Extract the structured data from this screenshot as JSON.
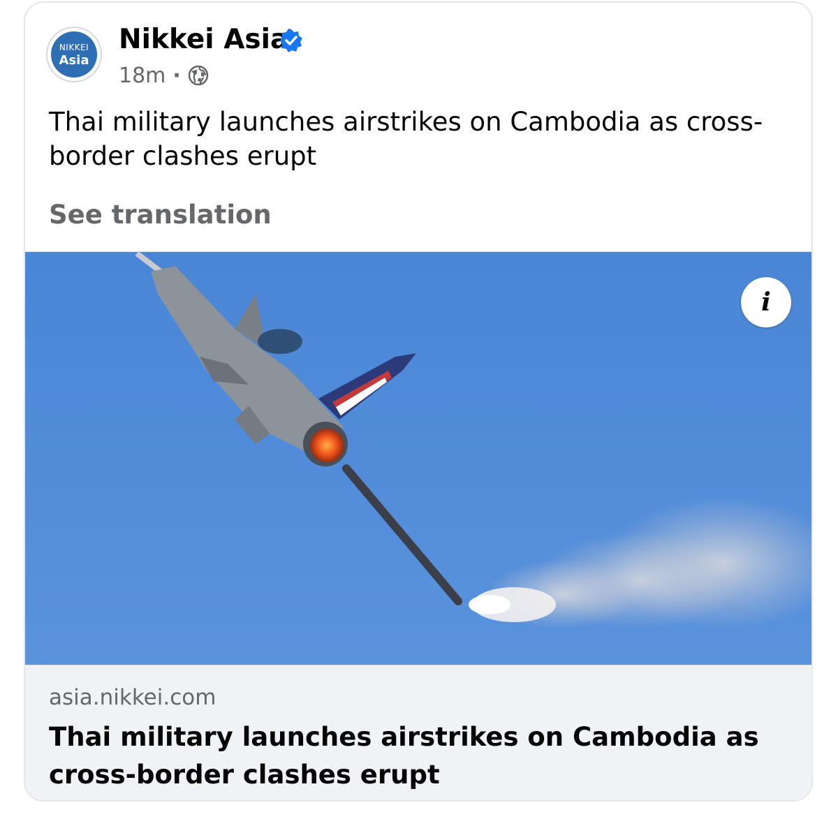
{
  "post": {
    "page_name": "Nikkei Asia",
    "avatar_line1": "NIKKEI",
    "avatar_line2": "Asia",
    "timestamp": "18m",
    "separator": "·",
    "audience_icon": "globe-icon",
    "verified_icon": "verified-badge-icon",
    "text": "Thai military launches airstrikes on Cambodia as cross-border clashes erupt",
    "see_translation": "See translation"
  },
  "attachment": {
    "info_icon": "info-icon",
    "info_label": "i",
    "domain": "asia.nikkei.com",
    "title": "Thai military launches airstrikes on Cambodia as cross-border clashes erupt"
  },
  "colors": {
    "sky": "#4f8ad8",
    "accent_blue": "#1877f2",
    "avatar_blue": "#2d6eb5",
    "secondary_text": "#65676b",
    "link_bg": "#f0f2f5"
  }
}
